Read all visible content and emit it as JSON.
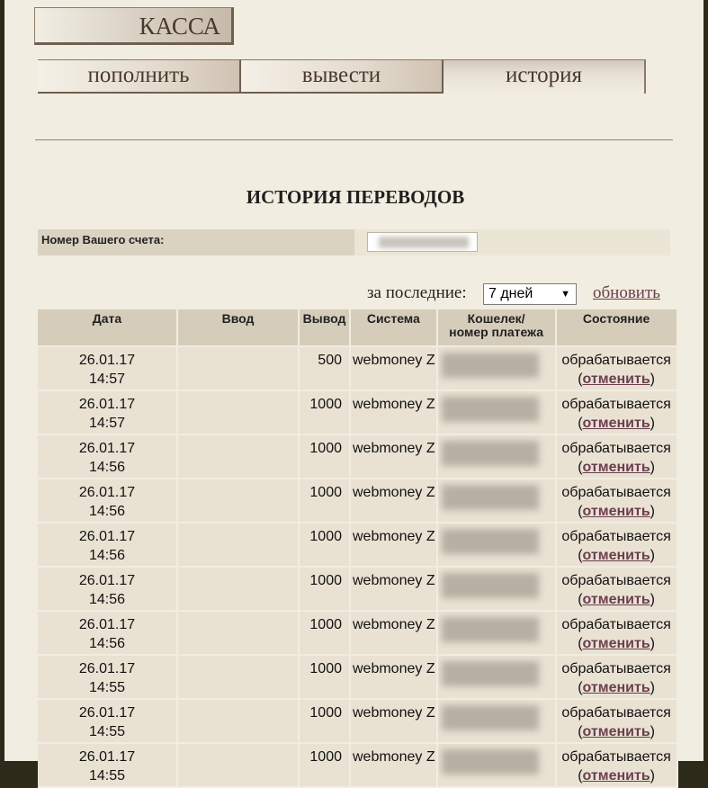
{
  "header": {
    "title": "КАССА"
  },
  "tabs": [
    {
      "label": "пополнить"
    },
    {
      "label": "вывести"
    },
    {
      "label": "история"
    }
  ],
  "section": {
    "title": "ИСТОРИЯ ПЕРЕВОДОВ"
  },
  "account": {
    "label": "Номер Вашего счета:"
  },
  "filter": {
    "label": "за последние:",
    "selected": "7 дней",
    "refresh": "обновить"
  },
  "table": {
    "columns": [
      "Дата",
      "Ввод",
      "Вывод",
      "Система",
      "Кошелек/\nномер платежа",
      "Состояние"
    ],
    "rows": [
      {
        "date": "26.01.17",
        "time": "14:57",
        "in": "",
        "out": "500",
        "system": "webmoney Z",
        "status": "обрабатывается",
        "cancel": "отменить"
      },
      {
        "date": "26.01.17",
        "time": "14:57",
        "in": "",
        "out": "1000",
        "system": "webmoney Z",
        "status": "обрабатывается",
        "cancel": "отменить"
      },
      {
        "date": "26.01.17",
        "time": "14:56",
        "in": "",
        "out": "1000",
        "system": "webmoney Z",
        "status": "обрабатывается",
        "cancel": "отменить"
      },
      {
        "date": "26.01.17",
        "time": "14:56",
        "in": "",
        "out": "1000",
        "system": "webmoney Z",
        "status": "обрабатывается",
        "cancel": "отменить"
      },
      {
        "date": "26.01.17",
        "time": "14:56",
        "in": "",
        "out": "1000",
        "system": "webmoney Z",
        "status": "обрабатывается",
        "cancel": "отменить"
      },
      {
        "date": "26.01.17",
        "time": "14:56",
        "in": "",
        "out": "1000",
        "system": "webmoney Z",
        "status": "обрабатывается",
        "cancel": "отменить"
      },
      {
        "date": "26.01.17",
        "time": "14:56",
        "in": "",
        "out": "1000",
        "system": "webmoney Z",
        "status": "обрабатывается",
        "cancel": "отменить"
      },
      {
        "date": "26.01.17",
        "time": "14:55",
        "in": "",
        "out": "1000",
        "system": "webmoney Z",
        "status": "обрабатывается",
        "cancel": "отменить"
      },
      {
        "date": "26.01.17",
        "time": "14:55",
        "in": "",
        "out": "1000",
        "system": "webmoney Z",
        "status": "обрабатывается",
        "cancel": "отменить"
      },
      {
        "date": "26.01.17",
        "time": "14:55",
        "in": "",
        "out": "1000",
        "system": "webmoney Z",
        "status": "обрабатывается",
        "cancel": "отменить"
      }
    ]
  }
}
